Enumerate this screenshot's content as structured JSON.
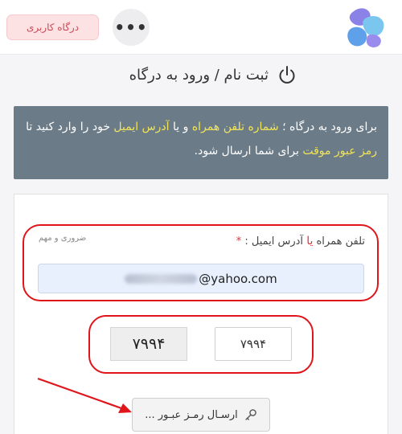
{
  "header": {
    "portal_label": "درگاه کاربری",
    "more_label": "•••"
  },
  "page": {
    "title": "ثبت نام / ورود به درگاه"
  },
  "info": {
    "p1": "برای ورود به درگاه ؛ ",
    "hl1": "شماره تلفن همراه",
    "p2": " و یا ",
    "hl2": "آدرس ایمیل",
    "p3": " خود را وارد کنید تا ",
    "hl3": "رمز عبور موقت",
    "p4": " برای شما ارسال شود."
  },
  "form": {
    "label_part1": "تلفن همراه ",
    "label_ya": "یا",
    "label_part2": " آدرس ایمیل : ",
    "label_star": "*",
    "required_note": "ضروری و مهم",
    "email_value": "@yahoo.com",
    "captcha_text": "۷۹۹۴",
    "captcha_value": "۷۹۹۴",
    "send_label": "ارسـال رمـز عبـور ..."
  },
  "colors": {
    "accent_red": "#e0151b",
    "highlight_yellow": "#f1e45a",
    "info_bg": "#6b7b87"
  }
}
